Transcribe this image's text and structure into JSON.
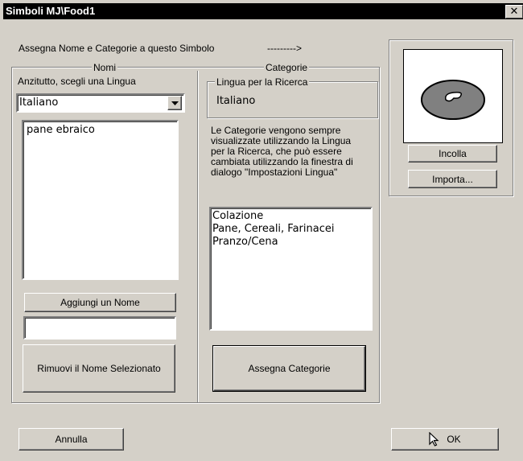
{
  "window": {
    "title": "Simboli MJ\\Food1",
    "close_glyph": "✕"
  },
  "header": {
    "instruction": "Assegna Nome e Categorie a questo Simbolo",
    "arrow": "--------->"
  },
  "nomi": {
    "legend": "Nomi",
    "choose_language_label": "Anzitutto, scegli una Lingua",
    "language_select_value": "Italiano",
    "names_list": [
      "pane ebraico"
    ],
    "add_button": "Aggiungi un Nome",
    "new_name_value": "",
    "remove_button": "Rimuovi il Nome Selezionato"
  },
  "categorie": {
    "legend": "Categorie",
    "search_language_legend": "Lingua per la Ricerca",
    "search_language_value": "Italiano",
    "info_lines": [
      "Le Categorie vengono sempre",
      "visualizzate utilizzando la Lingua",
      "per la Ricerca, che può essere",
      "cambiata utilizzando la finestra di",
      "dialogo \"Impostazioni Lingua\""
    ],
    "categories_list": [
      "Colazione",
      "Pane, Cereali, Farinacei",
      "Pranzo/Cena"
    ],
    "assign_button": "Assegna Categorie"
  },
  "symbol": {
    "paste_button": "Incolla",
    "import_button": "Importa..."
  },
  "footer": {
    "cancel_button": "Annulla",
    "ok_button": "OK"
  },
  "colors": {
    "face": "#d4d0c8",
    "title_bg": "#000000",
    "symbol_fill": "#808080"
  }
}
